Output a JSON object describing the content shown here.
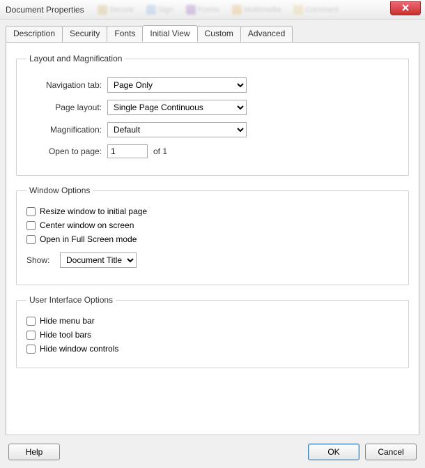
{
  "window": {
    "title": "Document Properties"
  },
  "tabs": {
    "t0": "Description",
    "t1": "Security",
    "t2": "Fonts",
    "t3": "Initial View",
    "t4": "Custom",
    "t5": "Advanced"
  },
  "layout": {
    "legend": "Layout and Magnification",
    "nav_label": "Navigation tab:",
    "nav_value": "Page Only",
    "layout_label": "Page layout:",
    "layout_value": "Single Page Continuous",
    "mag_label": "Magnification:",
    "mag_value": "Default",
    "open_label": "Open to page:",
    "open_value": "1",
    "open_suffix": "of 1"
  },
  "window_opts": {
    "legend": "Window Options",
    "resize": "Resize window to initial page",
    "center": "Center window on screen",
    "fullscreen": "Open in Full Screen mode",
    "show_label": "Show:",
    "show_value": "Document Title"
  },
  "ui_opts": {
    "legend": "User Interface Options",
    "hide_menu": "Hide menu bar",
    "hide_tool": "Hide tool bars",
    "hide_window": "Hide window controls"
  },
  "buttons": {
    "help": "Help",
    "ok": "OK",
    "cancel": "Cancel"
  }
}
